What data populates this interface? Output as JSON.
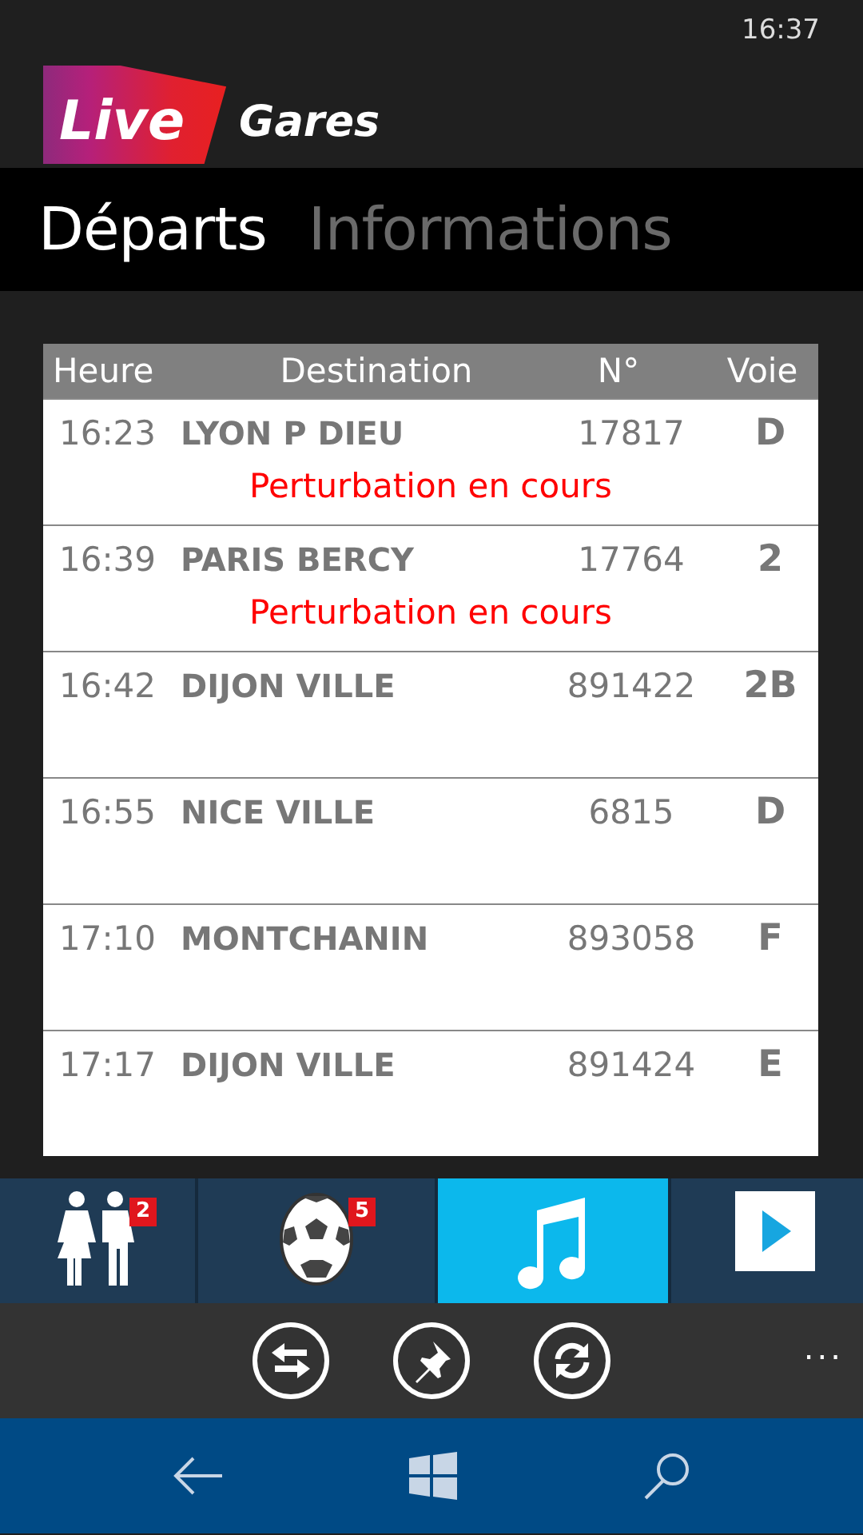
{
  "status_bar": {
    "time": "16:37"
  },
  "logo": {
    "badge_text": "Live",
    "name": "Gares"
  },
  "pivot": [
    {
      "label": "Départs",
      "selected": true
    },
    {
      "label": "Informations",
      "selected": false
    }
  ],
  "table": {
    "columns": [
      "Heure",
      "Destination",
      "N°",
      "Voie"
    ],
    "rows": [
      {
        "time": "16:23",
        "destination": "LYON P DIEU",
        "number": "17817",
        "track": "D",
        "alert": "Perturbation en cours"
      },
      {
        "time": "16:39",
        "destination": "PARIS BERCY",
        "number": "17764",
        "track": "2",
        "alert": "Perturbation en cours"
      },
      {
        "time": "16:42",
        "destination": "DIJON VILLE",
        "number": "891422",
        "track": "2B"
      },
      {
        "time": "16:55",
        "destination": "NICE VILLE",
        "number": "6815",
        "track": "D"
      },
      {
        "time": "17:10",
        "destination": "MONTCHANIN",
        "number": "893058",
        "track": "F"
      },
      {
        "time": "17:17",
        "destination": "DIJON VILLE",
        "number": "891424",
        "track": "E"
      }
    ]
  },
  "ad_tiles": [
    {
      "kind": "people",
      "badge": "2",
      "selected": false
    },
    {
      "kind": "ball",
      "badge": "5",
      "selected": false
    },
    {
      "kind": "music",
      "selected": true
    },
    {
      "kind": "video",
      "selected": false
    }
  ],
  "app_bar": {
    "buttons": [
      {
        "kind": "swap"
      },
      {
        "kind": "pin"
      },
      {
        "kind": "refresh"
      }
    ],
    "more": "..."
  }
}
